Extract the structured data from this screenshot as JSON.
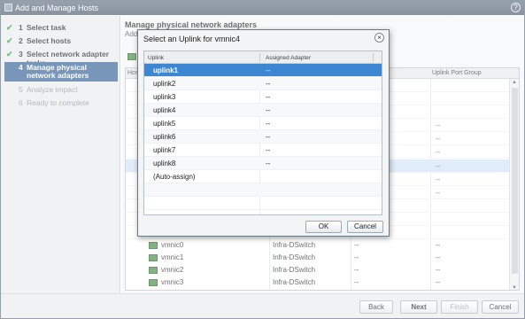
{
  "window": {
    "title": "Add and Manage Hosts"
  },
  "steps": [
    {
      "num": "1",
      "label": "Select task",
      "state": "done"
    },
    {
      "num": "2",
      "label": "Select hosts",
      "state": "done"
    },
    {
      "num": "3",
      "label": "Select network adapter tasks",
      "state": "done"
    },
    {
      "num": "4",
      "label": "Manage physical network adapters",
      "state": "current"
    },
    {
      "num": "5",
      "label": "Analyze impact",
      "state": "todo"
    },
    {
      "num": "6",
      "label": "Ready to complete",
      "state": "todo"
    }
  ],
  "main": {
    "title": "Manage physical network adapters",
    "subtitle": "Add",
    "grid": {
      "col_host": "Hos",
      "col_portgroup": "Uplink Port Group",
      "dashes": [
        "--",
        "--",
        "--",
        "--",
        "--",
        "--"
      ],
      "adapters": [
        {
          "name": "vmnic0",
          "switch": "Infra-DSwitch",
          "col3": "--",
          "col4": "--"
        },
        {
          "name": "vmnic1",
          "switch": "Infra-DSwitch",
          "col3": "--",
          "col4": "--"
        },
        {
          "name": "vmnic2",
          "switch": "Infra-DSwitch",
          "col3": "--",
          "col4": "--"
        },
        {
          "name": "vmnic3",
          "switch": "Infra-DSwitch",
          "col3": "--",
          "col4": "--"
        }
      ]
    }
  },
  "footer": {
    "back": "Back",
    "next": "Next",
    "finish": "Finish",
    "cancel": "Cancel"
  },
  "dialog": {
    "title": "Select an Uplink for vmnic4",
    "col_uplink": "Uplink",
    "col_adapter": "Assigned Adapter",
    "rows": [
      {
        "uplink": "uplink1",
        "adapter": "--",
        "selected": true
      },
      {
        "uplink": "uplink2",
        "adapter": "--"
      },
      {
        "uplink": "uplink3",
        "adapter": "--"
      },
      {
        "uplink": "uplink4",
        "adapter": "--"
      },
      {
        "uplink": "uplink5",
        "adapter": "--"
      },
      {
        "uplink": "uplink6",
        "adapter": "--"
      },
      {
        "uplink": "uplink7",
        "adapter": "--"
      },
      {
        "uplink": "uplink8",
        "adapter": "--"
      },
      {
        "uplink": "(Auto-assign)",
        "adapter": ""
      }
    ],
    "ok": "OK",
    "cancel": "Cancel"
  },
  "colors": {
    "accent": "#2f5f92",
    "selection": "#3d86d2",
    "check": "#2e9a3a"
  }
}
